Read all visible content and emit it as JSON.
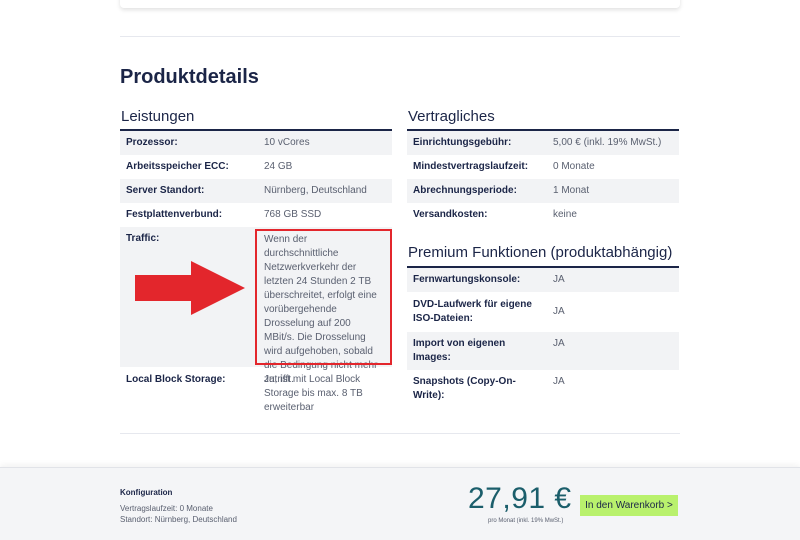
{
  "section_title": "Produktdetails",
  "leistungen": {
    "heading": "Leistungen",
    "rows": [
      {
        "key": "Prozessor:",
        "value": "10 vCores"
      },
      {
        "key": "Arbeitsspeicher ECC:",
        "value": "24 GB"
      },
      {
        "key": "Server Standort:",
        "value": "Nürnberg, Deutschland"
      },
      {
        "key": "Festplattenverbund:",
        "value": "768 GB SSD"
      },
      {
        "key": "Traffic:",
        "value": "Wenn der durchschnittliche Netzwerkverkehr der letzten 24 Stunden 2 TB überschreitet, erfolgt eine vorübergehende Drosselung auf 200 MBit/s. Die Drosselung wird aufgehoben, sobald die Bedingung nicht mehr zutrifft."
      },
      {
        "key": "Local Block Storage:",
        "value": "Ja, ist mit Local Block Storage bis max. 8 TB erweiterbar"
      }
    ]
  },
  "vertragliches": {
    "heading": "Vertragliches",
    "rows": [
      {
        "key": "Einrichtungsgebühr:",
        "value": "5,00 € (inkl. 19% MwSt.)"
      },
      {
        "key": "Mindestvertragslaufzeit:",
        "value": "0 Monate"
      },
      {
        "key": "Abrechnungsperiode:",
        "value": "1 Monat"
      },
      {
        "key": "Versandkosten:",
        "value": "keine"
      }
    ]
  },
  "premium": {
    "heading": "Premium Funktionen (produktabhängig)",
    "rows": [
      {
        "key": "Fernwartungskonsole:",
        "value": "JA"
      },
      {
        "key": "DVD-Laufwerk für eigene ISO-Dateien:",
        "value": "JA"
      },
      {
        "key": "Import von eigenen Images:",
        "value": "JA"
      },
      {
        "key": "Snapshots (Copy-On-Write):",
        "value": "JA"
      }
    ]
  },
  "footer": {
    "config_title": "Konfiguration",
    "config_line1": "Vertragslaufzeit: 0 Monate",
    "config_line2": "Standort: Nürnberg, Deutschland",
    "price": "27,91 €",
    "price_note": "pro Monat (inkl. 19% MwSt.)",
    "cart_button": "In den Warenkorb >"
  },
  "colors": {
    "navy": "#1b2547",
    "highlight_red": "#e3262c",
    "cart_green": "#b9f16d",
    "price_teal": "#1b5e6b"
  }
}
